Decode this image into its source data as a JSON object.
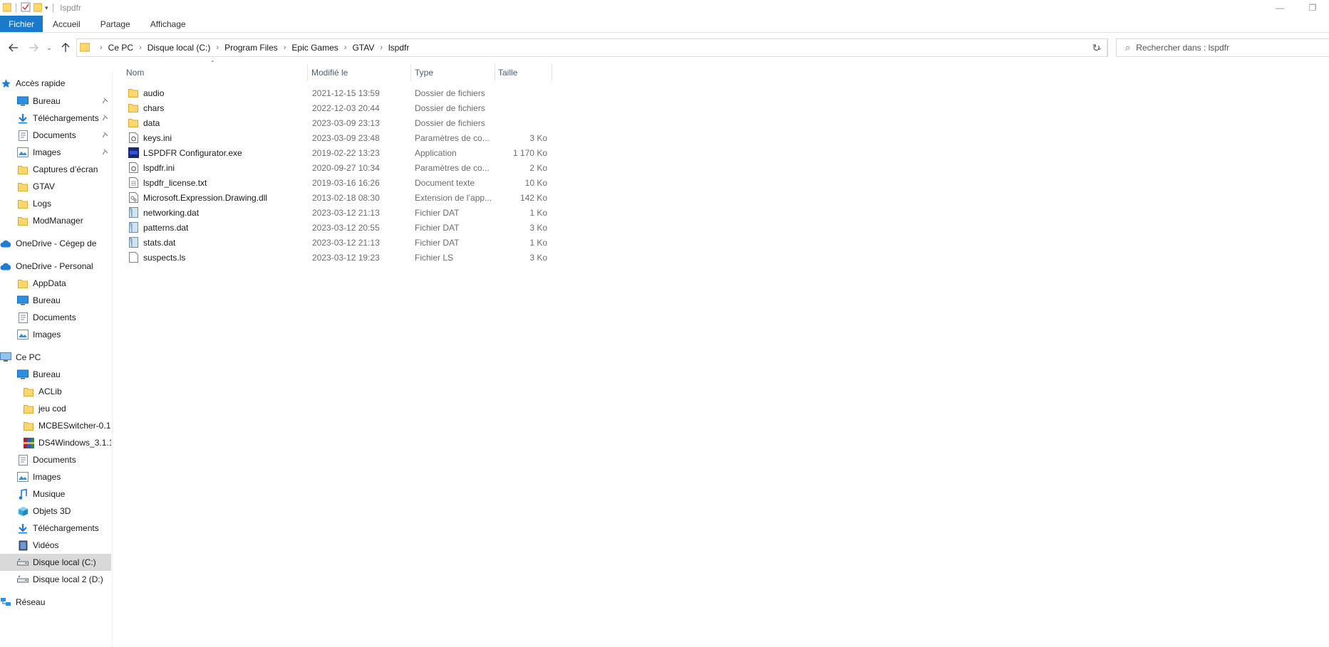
{
  "window": {
    "title": "lspdfr"
  },
  "ribbon": {
    "tabs": [
      "Fichier",
      "Accueil",
      "Partage",
      "Affichage"
    ]
  },
  "address": {
    "crumbs": [
      "Ce PC",
      "Disque local (C:)",
      "Program Files",
      "Epic Games",
      "GTAV",
      "lspdfr"
    ]
  },
  "search": {
    "placeholder": "Rechercher dans : lspdfr"
  },
  "sidebar": {
    "items": [
      {
        "label": "Accès rapide",
        "icon": "star-icon"
      },
      {
        "label": "Bureau",
        "icon": "desktop-icon",
        "pinned": true
      },
      {
        "label": "Téléchargements",
        "icon": "download-icon",
        "pinned": true
      },
      {
        "label": "Documents",
        "icon": "documents-icon",
        "pinned": true
      },
      {
        "label": "Images",
        "icon": "images-icon",
        "pinned": true
      },
      {
        "label": "Captures d’écran",
        "icon": "folder-icon"
      },
      {
        "label": "GTAV",
        "icon": "folder-icon"
      },
      {
        "label": "Logs",
        "icon": "folder-icon"
      },
      {
        "label": "ModManager",
        "icon": "folder-icon"
      },
      {
        "label": "OneDrive - Cégep de",
        "icon": "cloud-icon"
      },
      {
        "label": "OneDrive - Personal",
        "icon": "cloud-icon"
      },
      {
        "label": "AppData",
        "icon": "folder-icon"
      },
      {
        "label": "Bureau",
        "icon": "desktop-icon"
      },
      {
        "label": "Documents",
        "icon": "documents-icon"
      },
      {
        "label": "Images",
        "icon": "images-icon"
      },
      {
        "label": "Ce PC",
        "icon": "computer-icon"
      },
      {
        "label": "Bureau",
        "icon": "desktop-icon"
      },
      {
        "label": "ACLib",
        "icon": "folder-icon"
      },
      {
        "label": "jeu cod",
        "icon": "folder-icon"
      },
      {
        "label": "MCBESwitcher-0.1",
        "icon": "folder-icon"
      },
      {
        "label": "DS4Windows_3.1.1",
        "icon": "archive-icon"
      },
      {
        "label": "Documents",
        "icon": "documents-icon"
      },
      {
        "label": "Images",
        "icon": "images-icon"
      },
      {
        "label": "Musique",
        "icon": "music-icon"
      },
      {
        "label": "Objets 3D",
        "icon": "cube-icon"
      },
      {
        "label": "Téléchargements",
        "icon": "download-icon"
      },
      {
        "label": "Vidéos",
        "icon": "video-icon"
      },
      {
        "label": "Disque local (C:)",
        "icon": "drive-icon",
        "selected": true
      },
      {
        "label": "Disque local 2 (D:)",
        "icon": "drive-icon"
      },
      {
        "label": "Réseau",
        "icon": "network-icon"
      }
    ]
  },
  "files": {
    "headers": {
      "name": "Nom",
      "modified": "Modifié le",
      "type": "Type",
      "size": "Taille"
    },
    "rows": [
      {
        "name": "audio",
        "modified": "2021-12-15 13:59",
        "type": "Dossier de fichiers",
        "size": "",
        "icon": "folder-icon"
      },
      {
        "name": "chars",
        "modified": "2022-12-03 20:44",
        "type": "Dossier de fichiers",
        "size": "",
        "icon": "folder-icon"
      },
      {
        "name": "data",
        "modified": "2023-03-09 23:13",
        "type": "Dossier de fichiers",
        "size": "",
        "icon": "folder-icon"
      },
      {
        "name": "keys.ini",
        "modified": "2023-03-09 23:48",
        "type": "Paramètres de co...",
        "size": "3 Ko",
        "icon": "settings-file-icon"
      },
      {
        "name": "LSPDFR Configurator.exe",
        "modified": "2019-02-22 13:23",
        "type": "Application",
        "size": "1 170 Ko",
        "icon": "app-icon"
      },
      {
        "name": "lspdfr.ini",
        "modified": "2020-09-27 10:34",
        "type": "Paramètres de co...",
        "size": "2 Ko",
        "icon": "settings-file-icon"
      },
      {
        "name": "lspdfr_license.txt",
        "modified": "2019-03-16 16:26",
        "type": "Document texte",
        "size": "10 Ko",
        "icon": "text-file-icon"
      },
      {
        "name": "Microsoft.Expression.Drawing.dll",
        "modified": "2013-02-18 08:30",
        "type": "Extension de l’app...",
        "size": "142 Ko",
        "icon": "dll-file-icon"
      },
      {
        "name": "networking.dat",
        "modified": "2023-03-12 21:13",
        "type": "Fichier DAT",
        "size": "1 Ko",
        "icon": "dat-file-icon"
      },
      {
        "name": "patterns.dat",
        "modified": "2023-03-12 20:55",
        "type": "Fichier DAT",
        "size": "3 Ko",
        "icon": "dat-file-icon"
      },
      {
        "name": "stats.dat",
        "modified": "2023-03-12 21:13",
        "type": "Fichier DAT",
        "size": "1 Ko",
        "icon": "dat-file-icon"
      },
      {
        "name": "suspects.ls",
        "modified": "2023-03-12 19:23",
        "type": "Fichier LS",
        "size": "3 Ko",
        "icon": "blank-file-icon"
      }
    ]
  },
  "colors": {
    "accent": "#1979ca",
    "folder": "#ffd76a",
    "selected": "#d9d9d9",
    "header_text": "#4c607a"
  }
}
